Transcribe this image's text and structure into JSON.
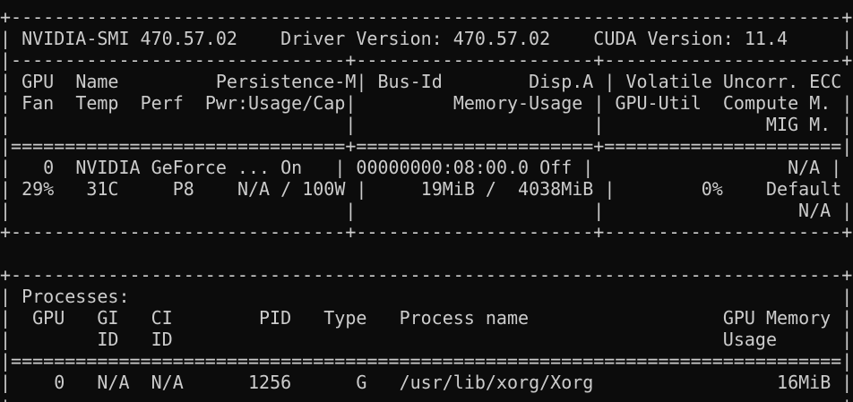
{
  "window": {
    "background_color": "#0c0c0c",
    "text_color": "#cccccc"
  },
  "nvidia_smi": {
    "header": {
      "smi_version": "NVIDIA-SMI 470.57.02",
      "driver_version": "Driver Version: 470.57.02",
      "cuda_version": "CUDA Version: 11.4"
    },
    "gpu_table": {
      "headers": [
        [
          "GPU",
          "Name",
          "Persistence-M",
          "Bus-Id",
          "Disp.A",
          "Volatile Uncorr. ECC"
        ],
        [
          "Fan",
          "Temp",
          "Perf",
          "Pwr:Usage/Cap",
          "Memory-Usage",
          "GPU-Util",
          "Compute M."
        ],
        [
          "MIG M."
        ]
      ],
      "gpus": [
        {
          "index": "0",
          "name": "NVIDIA GeForce ...",
          "persistence_mode": "On",
          "bus_id": "00000000:08:00.0",
          "display_active": "Off",
          "ecc": "N/A",
          "fan": "29%",
          "temp": "31C",
          "perf": "P8",
          "power": "N/A / 100W",
          "memory_usage": "19MiB /  4038MiB",
          "gpu_util": "0%",
          "compute_mode": "Default",
          "mig_mode": "N/A"
        }
      ]
    },
    "process_table": {
      "title": "Processes:",
      "headers": [
        [
          "GPU",
          "GI",
          "CI",
          "PID",
          "Type",
          "Process name",
          "GPU Memory"
        ],
        [
          "ID",
          "ID",
          "Usage"
        ]
      ],
      "rows": [
        {
          "gpu": "0",
          "gi_id": "N/A",
          "ci_id": "N/A",
          "pid": "1256",
          "type": "G",
          "process_name": "/usr/lib/xorg/Xorg",
          "gpu_memory": "16MiB"
        }
      ]
    }
  }
}
